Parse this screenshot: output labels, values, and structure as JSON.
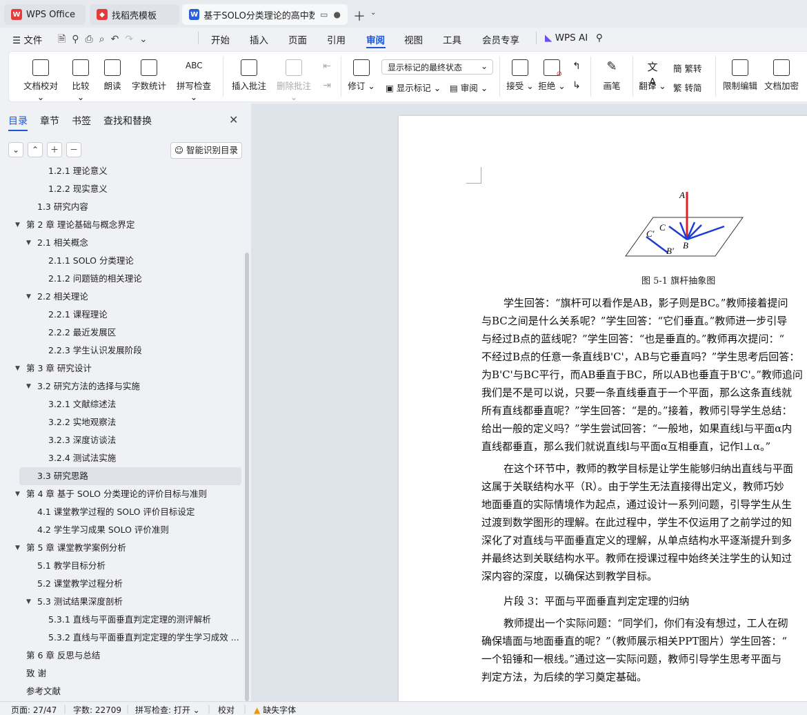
{
  "tabs": [
    {
      "label": "WPS Office",
      "icon": "wps-logo-icon"
    },
    {
      "label": "找稻壳模板",
      "icon": "docer-icon"
    },
    {
      "label": "基于SOLO分类理论的高中数学",
      "icon": "word-doc-icon"
    }
  ],
  "menu": {
    "file": "文件",
    "items": [
      "开始",
      "插入",
      "页面",
      "引用",
      "审阅",
      "视图",
      "工具",
      "会员专享"
    ],
    "active": "审阅",
    "wps_ai": "WPS AI"
  },
  "ribbon": {
    "proofread": "文档校对",
    "compare": "比较",
    "read_aloud": "朗读",
    "word_count": "字数统计",
    "spell_check": "拼写检查",
    "insert_comment": "插入批注",
    "delete_comment": "删除批注",
    "revise": "修订",
    "markup_select": "显示标记的最终状态",
    "show_markup": "显示标记",
    "review": "审阅",
    "accept": "接受",
    "reject": "拒绝",
    "pen": "画笔",
    "translate": "翻译",
    "to_traditional": "繁转",
    "to_simplified": "转简",
    "restrict_edit": "限制编辑",
    "encrypt": "文档加密"
  },
  "sidebar": {
    "tabs": [
      "目录",
      "章节",
      "书签",
      "查找和替换"
    ],
    "smart_toc": "智能识别目录",
    "toc": [
      {
        "label": "1.2.1  理论意义",
        "level": 3
      },
      {
        "label": "1.2.2  现实意义",
        "level": 3
      },
      {
        "label": "1.3  研究内容",
        "level": 2
      },
      {
        "label": "第 2 章  理论基础与概念界定",
        "level": 1
      },
      {
        "label": "2.1  相关概念",
        "level": 2
      },
      {
        "label": "2.1.1 SOLO 分类理论",
        "level": 3
      },
      {
        "label": "2.1.2  问题链的相关理论",
        "level": 3
      },
      {
        "label": "2.2  相关理论",
        "level": 2
      },
      {
        "label": "2.2.1  课程理论",
        "level": 3
      },
      {
        "label": "2.2.2  最近发展区",
        "level": 3
      },
      {
        "label": "2.2.3  学生认识发展阶段",
        "level": 3
      },
      {
        "label": "第 3 章  研究设计",
        "level": 1
      },
      {
        "label": "3.2  研究方法的选择与实施",
        "level": 2
      },
      {
        "label": "3.2.1  文献综述法",
        "level": 3
      },
      {
        "label": "3.2.2  实地观察法",
        "level": 3
      },
      {
        "label": "3.2.3  深度访谈法",
        "level": 3
      },
      {
        "label": "3.2.4  测试法实施",
        "level": 3
      },
      {
        "label": "3.3  研究思路",
        "level": 2
      },
      {
        "label": "第 4 章  基于 SOLO 分类理论的评价目标与准则",
        "level": 1
      },
      {
        "label": "4.1  课堂教学过程的 SOLO 评价目标设定",
        "level": 2
      },
      {
        "label": "4.2  学生学习成果 SOLO 评价准则",
        "level": 2
      },
      {
        "label": "第 5 章  课堂教学案例分析",
        "level": 1
      },
      {
        "label": "5.1  教学目标分析",
        "level": 2
      },
      {
        "label": "5.2  课堂教学过程分析",
        "level": 2
      },
      {
        "label": "5.3  测试结果深度剖析",
        "level": 2
      },
      {
        "label": "5.3.1  直线与平面垂直判定定理的测评解析",
        "level": 3
      },
      {
        "label": "5.3.2  直线与平面垂直判定定理的学生学习成效 ...",
        "level": 3
      },
      {
        "label": "第 6 章  反思与总结",
        "level": 1
      },
      {
        "label": "致    谢",
        "level": 1
      },
      {
        "label": "参考文献",
        "level": 1
      }
    ]
  },
  "figure": {
    "caption": "图  5-1  旗杆抽象图",
    "labels": [
      "A",
      "C",
      "C'",
      "B",
      "B'"
    ]
  },
  "paragraphs": [
    "学生回答：“旗杆可以看作是AB，影子则是BC。”教师接着提问",
    "与BC之间是什么关系呢？”学生回答：“它们垂直。”教师进一步引导",
    "与经过B点的蓝线呢？”学生回答：“也是垂直的。”教师再次提问：“",
    "不经过B点的任意一条直线B'C'，AB与它垂直吗？”学生思考后回答：",
    "为B'C'与BC平行，而AB垂直于BC，所以AB也垂直于B'C'。”教师追问",
    "我们是不是可以说，只要一条直线垂直于一个平面，那么这条直线就",
    "所有直线都垂直呢？”学生回答：“是的。”接着，教师引导学生总结：",
    "给出一般的定义吗？”学生尝试回答：“一般地，如果直线l与平面α内",
    "直线都垂直，那么我们就说直线l与平面α互相垂直，记作l⊥α。”",
    "在这个环节中，教师的教学目标是让学生能够归纳出直线与平面",
    "这属于关联结构水平（R）。由于学生无法直接得出定义，教师巧妙",
    "地面垂直的实际情境作为起点，通过设计一系列问题，引导学生从生",
    "过渡到数学图形的理解。在此过程中，学生不仅运用了之前学过的知",
    "深化了对直线与平面垂直定义的理解，从单点结构水平逐渐提升到多",
    "并最终达到关联结构水平。教师在授课过程中始终关注学生的认知过",
    "深内容的深度，以确保达到教学目标。",
    "片段  3：平面与平面垂直判定定理的归纳",
    "教师提出一个实际问题：“同学们，你们有没有想过，工人在砌",
    "确保墙面与地面垂直的呢？”（教师展示相关PPT图片）学生回答：“",
    "一个铅锤和一根线。”通过这一实际问题，教师引导学生思考平面与",
    "判定方法，为后续的学习奠定基础。"
  ],
  "status": {
    "page": "页面: 27/47",
    "words": "字数: 22709",
    "spell": "拼写检查: 打开",
    "proof": "校对",
    "missing_font": "缺失字体"
  },
  "colors": {
    "accent": "#1a56db",
    "wps_red": "#e23d3d",
    "figure_red": "#e02020",
    "figure_blue": "#1a3bd6"
  }
}
